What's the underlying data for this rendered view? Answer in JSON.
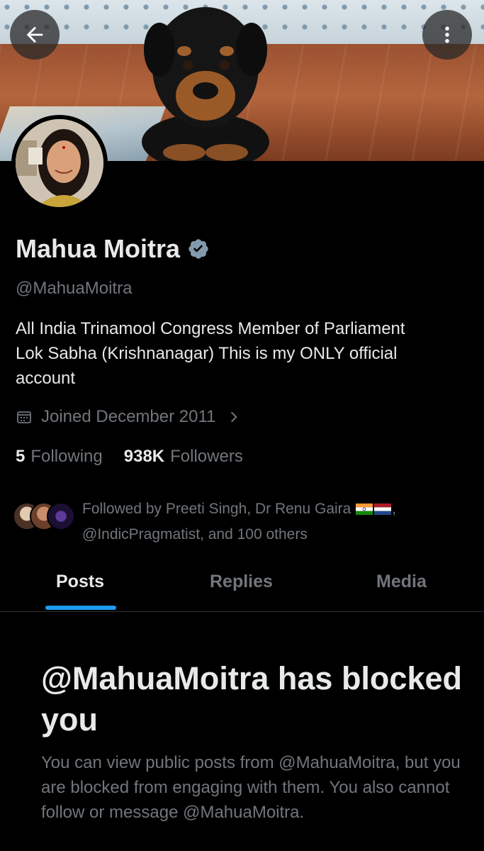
{
  "header": {
    "back_icon": "arrow-left-icon",
    "more_icon": "more-vertical-icon"
  },
  "profile": {
    "name": "Mahua Moitra",
    "verified": true,
    "handle": "@MahuaMoitra",
    "bio_lines": [
      "All India Trinamool Congress Member of Parliament",
      "Lok Sabha (Krishnanagar) This is my ONLY official",
      "account"
    ],
    "joined": "Joined December 2011",
    "following_count": "5",
    "following_label": "Following",
    "followers_count": "938K",
    "followers_label": "Followers",
    "followed_by_line1": "Followed by Preeti Singh, Dr Renu Gaira",
    "followed_by_line1_suffix": ",",
    "followed_by_line2": "@IndicPragmatist, and 100 others"
  },
  "tabs": [
    {
      "label": "Posts",
      "active": true
    },
    {
      "label": "Replies",
      "active": false
    },
    {
      "label": "Media",
      "active": false
    }
  ],
  "blocked": {
    "title": "@MahuaMoitra has blocked you",
    "body": "You can view public posts from @MahuaMoitra, but you are blocked from engaging with them. You also cannot follow or message @MahuaMoitra."
  },
  "colors": {
    "accent": "#1d9bf0",
    "background": "#000000",
    "secondary_text": "#71767b",
    "verified_badge": "#829aab"
  }
}
